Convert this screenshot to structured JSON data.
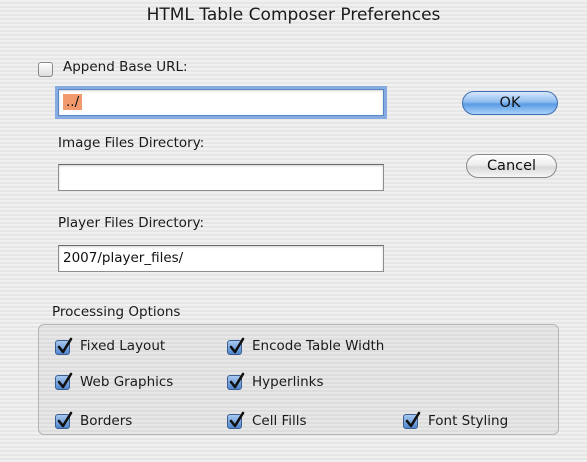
{
  "window": {
    "title": "HTML Table Composer Preferences"
  },
  "base_url": {
    "checkbox_label": "Append Base URL:",
    "checked": false,
    "value": "../"
  },
  "image_dir": {
    "label": "Image Files Directory:",
    "value": ""
  },
  "player_dir": {
    "label": "Player Files Directory:",
    "value": "2007/player_files/"
  },
  "buttons": {
    "ok": "OK",
    "cancel": "Cancel"
  },
  "processing": {
    "title": "Processing Options",
    "options": [
      {
        "label": "Fixed Layout",
        "checked": true
      },
      {
        "label": "Encode Table Width",
        "checked": true
      },
      {
        "label": "Web Graphics",
        "checked": true
      },
      {
        "label": "Hyperlinks",
        "checked": true
      },
      {
        "label": "Borders",
        "checked": true
      },
      {
        "label": "Cell Fills",
        "checked": true
      },
      {
        "label": "Font Styling",
        "checked": true
      }
    ]
  },
  "colors": {
    "accent_blue": "#4f86cf",
    "selection_orange": "#f29a6e",
    "focus_ring": "#85abe0"
  },
  "icons": [
    "checkbox-checked-icon",
    "checkbox-empty-icon"
  ]
}
